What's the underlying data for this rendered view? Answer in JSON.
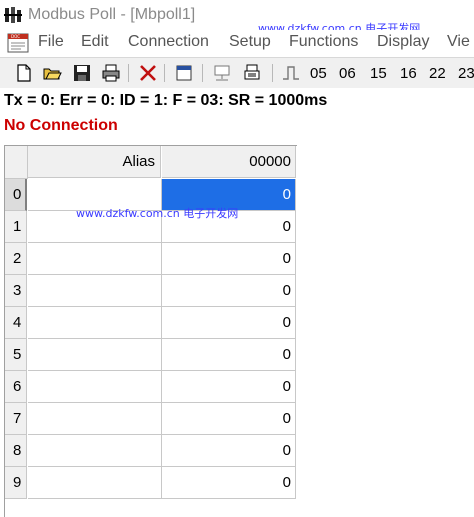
{
  "window": {
    "title": "Modbus Poll - [Mbpoll1]",
    "icon": "modbus-poll-app-icon"
  },
  "watermarks": {
    "top": "www.dzkfw.com.cn 电子开发网",
    "middle": "www.dzkfw.com.cn 电子开发网"
  },
  "menu": {
    "items": [
      "File",
      "Edit",
      "Connection",
      "Setup",
      "Functions",
      "Display",
      "Vie"
    ]
  },
  "toolbar": {
    "icons": [
      "new-document-icon",
      "open-folder-icon",
      "save-disk-icon",
      "print-icon",
      "close-x-icon",
      "window-icon",
      "connect-icon",
      "disconnect-icon",
      "pulse-icon"
    ],
    "function_buttons": [
      "05",
      "06",
      "15",
      "16",
      "22",
      "23"
    ]
  },
  "status": {
    "line1": "Tx = 0: Err = 0: ID = 1: F = 03: SR = 1000ms",
    "line2": "No Connection",
    "line2_color": "#cc0000"
  },
  "grid": {
    "alias_header": "Alias",
    "column_header": "00000",
    "selection_color": "#1e6ee6",
    "rows": [
      {
        "index": "0",
        "alias": "",
        "value": "0",
        "selected": true
      },
      {
        "index": "1",
        "alias": "",
        "value": "0"
      },
      {
        "index": "2",
        "alias": "",
        "value": "0"
      },
      {
        "index": "3",
        "alias": "",
        "value": "0"
      },
      {
        "index": "4",
        "alias": "",
        "value": "0"
      },
      {
        "index": "5",
        "alias": "",
        "value": "0"
      },
      {
        "index": "6",
        "alias": "",
        "value": "0"
      },
      {
        "index": "7",
        "alias": "",
        "value": "0"
      },
      {
        "index": "8",
        "alias": "",
        "value": "0"
      },
      {
        "index": "9",
        "alias": "",
        "value": "0"
      }
    ]
  }
}
